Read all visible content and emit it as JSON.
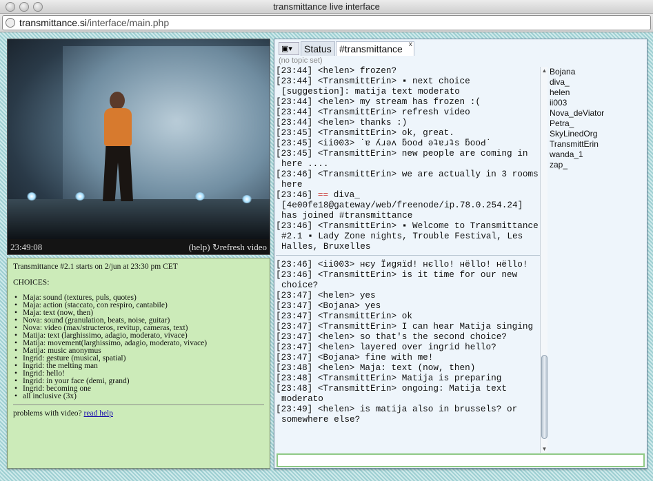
{
  "window": {
    "title": "transmittance live interface"
  },
  "urlbar": {
    "domain": "transmittance.si",
    "path": "/interface/main.php"
  },
  "video": {
    "time": "23:49:08",
    "help_label": "(help)",
    "refresh_label": "refresh video"
  },
  "info": {
    "intro": "Transmittance #2.1 starts on 2/jun at 23:30 pm CET",
    "choices_heading": "CHOICES:",
    "choices": [
      "Maja: sound (textures, puls, quotes)",
      "Maja: action (staccato, con respiro, cantabile)",
      "Maja: text (now, then)",
      "Nova: sound (granulation, beats, noise, guitar)",
      "Nova: video (max/structeros, revitup, cameras, text)",
      "Matija: text (larghissimo, adagio, moderato, vivace)",
      "Matija: movement(larghissimo, adagio, moderato, vivace)",
      "Matija: music anonymus",
      "Ingrid: gesture (musical, spatial)",
      "Ingrid: the melting man",
      "Ingrid: hello!",
      "Ingrid: in your face (demi, grand)",
      "Ingrid: becoming one",
      "all inclusive (3x)"
    ],
    "problems_text": "problems with video?",
    "read_help": "read help"
  },
  "chat": {
    "menu_icon": "irc-menu-icon",
    "tabs": [
      {
        "label": "Status"
      },
      {
        "label": "#transmittance",
        "close": "x"
      }
    ],
    "topic": "(no topic set)",
    "log_before": [
      "[23:44] <helen> frozen?",
      "[23:44] <TransmittErin> ▪ next choice [suggestion]: matija text moderato",
      "[23:44] <helen> my stream has frozen :(",
      "[23:44] <TransmittErin> refresh video",
      "[23:44] <helen> thanks :)",
      "[23:45] <TransmittErin> ok, great.",
      "[23:45] <ii003> ˙ɐ ʎɹǝʌ ƃooԀ ǝʇɐɹʇs ƃooԀ˙",
      "[23:45] <TransmittErin> new people are coming in here ....",
      "[23:46] <TransmittErin> we are actually in 3 rooms here"
    ],
    "join": {
      "time": "[23:46]",
      "marker": "==",
      "text": "diva_ [4e00fe18@gateway/web/freenode/ip.78.0.254.24] has joined #transmittance"
    },
    "welcome": "[23:46] <TransmittErin> ▪ Welcome to Transmittance #2.1 ▪ Lady Zone nights, Trouble Festival, Les Halles, Bruxelles",
    "log_after": [
      "[23:46] <ii003> нєу Їиgяїd! нєllо! нёllо! нёllо!",
      "[23:46] <TransmittErin> is it time for our new choice?",
      "[23:47] <helen> yes",
      "[23:47] <Bojana> yes",
      "[23:47] <TransmittErin> ok",
      "[23:47] <TransmittErin> I can hear Matija singing",
      "[23:47] <helen> so that's the second choice?",
      "[23:47] <helen> layered over ingrid hello?",
      "[23:47] <Bojana> fine with me!",
      "[23:48] <helen> Maja: text (now, then)",
      "[23:48] <TransmittErin> Matija is preparing",
      "[23:48] <TransmittErin> ongoing: Matija text moderato",
      "[23:49] <helen> is matija also in brussels? or somewhere else?"
    ],
    "users": [
      "Bojana",
      "diva_",
      "helen",
      "ii003",
      "Nova_deViator",
      "Petra_",
      "SkyLinedOrg",
      "TransmittErin",
      "wanda_1",
      "zap_"
    ],
    "input_value": ""
  }
}
